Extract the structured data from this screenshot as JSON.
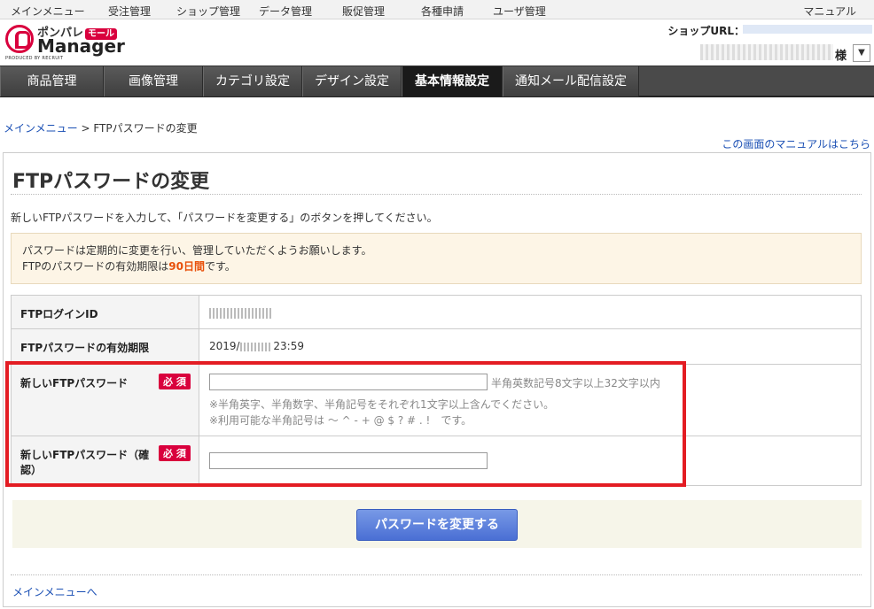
{
  "top_menu": {
    "items": [
      "メインメニュー",
      "受注管理",
      "ショップ管理",
      "データ管理",
      "販促管理",
      "各種申請",
      "ユーザ管理"
    ],
    "manual": "マニュアル"
  },
  "header": {
    "logo_top": "ポンパレ",
    "logo_mall": "モール",
    "logo_main": "Manager",
    "logo_produced": "PRODUCED BY RECRUIT",
    "shop_url_label": "ショップURL：",
    "shop_suffix": "様",
    "dropdown_glyph": "▼"
  },
  "nav": {
    "tabs": [
      {
        "label": "商品管理"
      },
      {
        "label": "画像管理"
      },
      {
        "label": "カテゴリ設定"
      },
      {
        "label": "デザイン設定"
      },
      {
        "label": "基本情報設定",
        "active": true
      },
      {
        "label": "通知メール配信設定"
      }
    ]
  },
  "breadcrumb": {
    "home": "メインメニュー",
    "sep": " > ",
    "current": "FTPパスワードの変更"
  },
  "manual_link": "この画面のマニュアルはこちら",
  "page": {
    "title": "FTPパスワードの変更",
    "intro": "新しいFTPパスワードを入力して、「パスワードを変更する」のボタンを押してください。",
    "notice_line1": "パスワードは定期的に変更を行い、管理していただくようお願いします。",
    "notice_line2_pre": "FTPのパスワードの有効期限は",
    "notice_line2_em": "90日間",
    "notice_line2_post": "です。"
  },
  "form": {
    "login_id_label": "FTPログインID",
    "expiry_label": "FTPパスワードの有効期限",
    "expiry_value_pre": "2019/",
    "expiry_value_post": " 23:59",
    "new_pw_label": "新しいFTPパスワード",
    "new_pw_hint": "半角英数記号8文字以上32文字以内",
    "new_pw_note1": "※半角英字、半角数字、半角記号をそれぞれ1文字以上含んでください。",
    "new_pw_note2": "※利用可能な半角記号は ～ ^ - + @ $ ? # . !　です。",
    "confirm_label_1": "新しいFTPパスワード（確",
    "confirm_label_2": "認）",
    "required": "必 須",
    "submit": "パスワードを変更する"
  },
  "back_link": "メインメニューへ",
  "colors": {
    "accent_red": "#e31c23",
    "brand_red": "#d9003d",
    "button_blue": "#4a6fd4",
    "nav_dark": "#4a4a4a",
    "notice_bg": "#fdf5e6"
  }
}
